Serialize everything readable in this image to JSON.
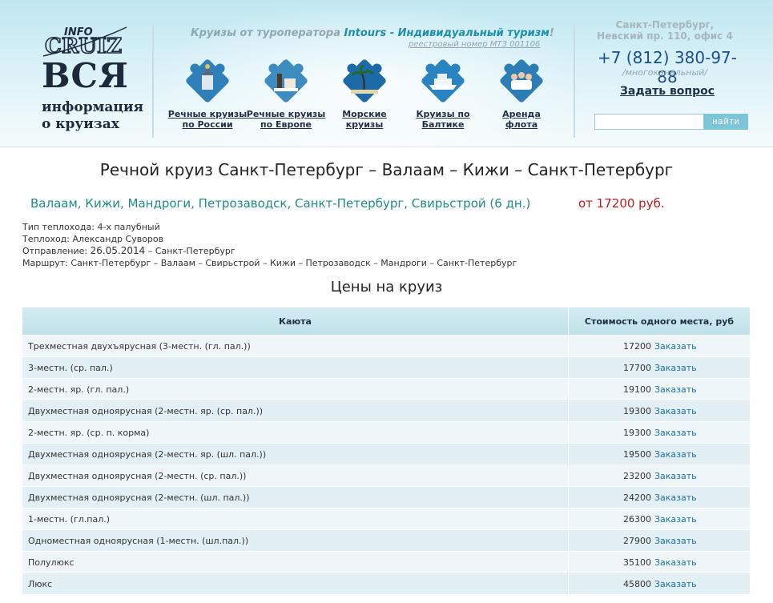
{
  "header": {
    "logo_mark": "INFO CRUIZ",
    "logo_title": "ВСЯ",
    "logo_sub1": "информация",
    "logo_sub2": "о круизах",
    "tagline_prefix": "Круизы от туроператора",
    "tagline_brand": "Intours - Индивидуальный туризм",
    "tagline_suffix": "!",
    "registry": "реестровый номер МТЗ 001106",
    "nav": [
      {
        "line1": "Речные круизы",
        "line2": "по России",
        "icon": "church-puzzle-icon"
      },
      {
        "line1": "Речные круизы",
        "line2": "по Европе",
        "icon": "city-puzzle-icon"
      },
      {
        "line1": "Морские",
        "line2": "круизы",
        "icon": "palm-puzzle-icon"
      },
      {
        "line1": "Круизы по",
        "line2": "Балтике",
        "icon": "ship-puzzle-icon"
      },
      {
        "line1": "Аренда",
        "line2": "флота",
        "icon": "people-puzzle-icon"
      }
    ],
    "address1": "Санкт-Петербург,",
    "address2": "Невский пр. 110, офис 4",
    "phone": "+7 (812) 380-97-88",
    "phone_note": "/многоканальный/",
    "ask": "Задать вопрос",
    "search_button": "найти",
    "search_value": ""
  },
  "cruise": {
    "title": "Речной круиз Санкт-Петербург – Валаам – Кижи – Санкт-Петербург",
    "route_summary": "Валаам, Кижи, Мандроги, Петрозаводск, Санкт-Петербург, Свирьстрой (6 дн.)",
    "price_from": "от 17200 руб.",
    "ship_type_label": "Тип теплохода:",
    "ship_type": "4-х палубный",
    "ship_label": "Теплоход:",
    "ship": "Александр Суворов",
    "departure_label": "Отправление:",
    "departure_date": "26.05.2014",
    "departure_place": "– Санкт-Петербург",
    "route_label": "Маршрут:",
    "route": "Санкт-Петербург – Валаам – Свирьстрой – Кижи – Петрозаводск – Мандроги – Санкт-Петербург"
  },
  "prices": {
    "title": "Цены на круиз",
    "col_cabin": "Каюта",
    "col_price": "Стоимость одного места, руб",
    "order_label": "Заказать",
    "rows": [
      {
        "cabin": "Трехместная двухъярусная (3-местн. (гл. пал.))",
        "price": "17200"
      },
      {
        "cabin": "3-местн. (ср. пал.)",
        "price": "17700"
      },
      {
        "cabin": "2-местн. яр. (гл. пал.)",
        "price": "19100"
      },
      {
        "cabin": "Двухместная одноярусная (2-местн. яр. (ср. пал.))",
        "price": "19300"
      },
      {
        "cabin": "2-местн. яр. (ср. п. корма)",
        "price": "19300"
      },
      {
        "cabin": "Двухместная одноярусная (2-местн. яр. (шл. пал.))",
        "price": "19500"
      },
      {
        "cabin": "Двухместная одноярусная (2-местн. (ср. пал.))",
        "price": "23200"
      },
      {
        "cabin": "Двухместная одноярусная (2-местн. (шл. пал.))",
        "price": "24200"
      },
      {
        "cabin": "1-местн. (гл.пал.)",
        "price": "26300"
      },
      {
        "cabin": "Одноместная одноярусная (1-местн. (шл.пал.))",
        "price": "27900"
      },
      {
        "cabin": "Полулюкс",
        "price": "35100"
      },
      {
        "cabin": "Люкс",
        "price": "45800"
      }
    ]
  },
  "colors": {
    "accent": "#1f8a8a",
    "price": "#c0191c",
    "link": "#1d6fa2",
    "header_bg": "#bfe7f1"
  }
}
